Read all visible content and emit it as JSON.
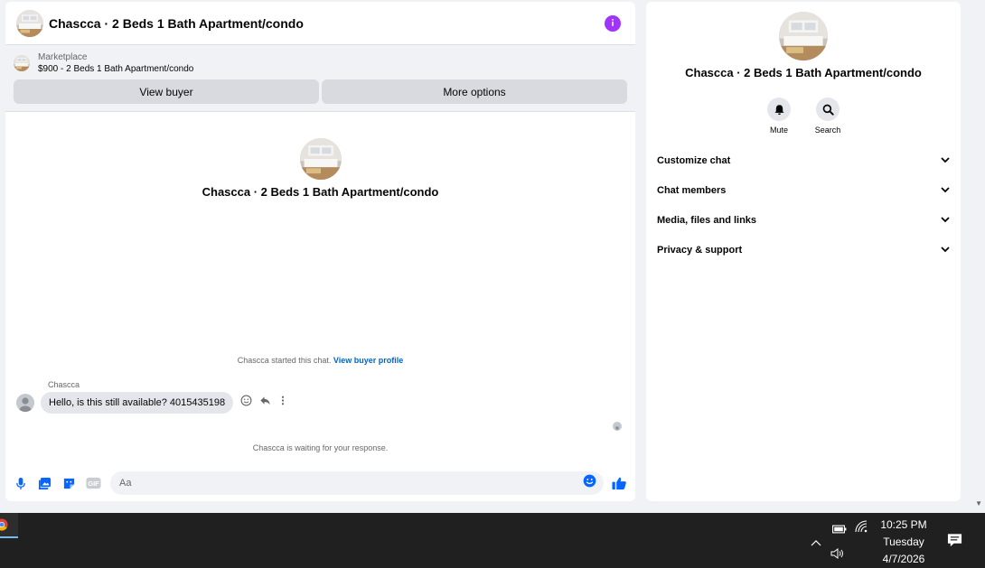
{
  "chat": {
    "title": "Chascca · 2 Beds 1 Bath Apartment/condo",
    "listing": {
      "label": "Marketplace",
      "price_title": "$900 - 2 Beds 1 Bath Apartment/condo",
      "view_buyer": "View buyer",
      "more_options": "More options"
    },
    "intro_name": "Chascca · 2 Beds 1 Bath Apartment/condo",
    "started_text": "Chascca started this chat.",
    "view_buyer_profile": "View buyer profile",
    "sender": "Chascca",
    "message": "Hello, is this still available? 4015435198",
    "waiting_text": "Chascca is waiting for your response.",
    "composer_placeholder": "Aa"
  },
  "info": {
    "name": "Chascca · 2 Beds 1 Bath Apartment/condo",
    "mute_label": "Mute",
    "search_label": "Search",
    "sections": [
      "Customize chat",
      "Chat members",
      "Media, files and links",
      "Privacy & support"
    ]
  },
  "taskbar": {
    "time": "10:25 PM",
    "day": "Tuesday",
    "date": "4/7/2026"
  },
  "colors": {
    "accent": "#0866ff",
    "info_button": "#a033ff",
    "link": "#0064d1"
  }
}
